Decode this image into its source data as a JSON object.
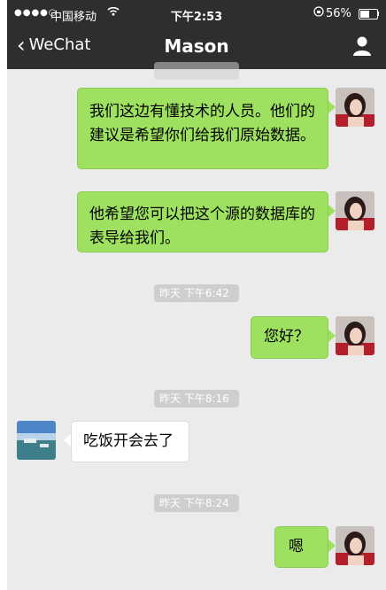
{
  "status_bar": {
    "signal": "●●●●○",
    "carrier": "中国移动",
    "time": "下午2:53",
    "battery": "56%",
    "battery_level": 0.56
  },
  "header": {
    "back_label": "WeChat",
    "title": "Mason"
  },
  "messages": {
    "m1": "我们这边有懂技术的人员。他们的建议是希望你们给我们原始数据。",
    "m2": "他希望您可以把这个源的数据库的表导给我们。",
    "t1": "昨天 下午6:42",
    "m3": "您好？",
    "t2": "昨天 下午8:16",
    "m4": "吃饭开会去了",
    "t3": "昨天 下午8:24",
    "m5": "嗯"
  },
  "colors": {
    "header_bg": "#2e2e2f",
    "chat_bg": "#ebebeb",
    "outgoing_bubble": "#9ee160",
    "incoming_bubble": "#ffffff",
    "timestamp_bg": "#cecece"
  }
}
